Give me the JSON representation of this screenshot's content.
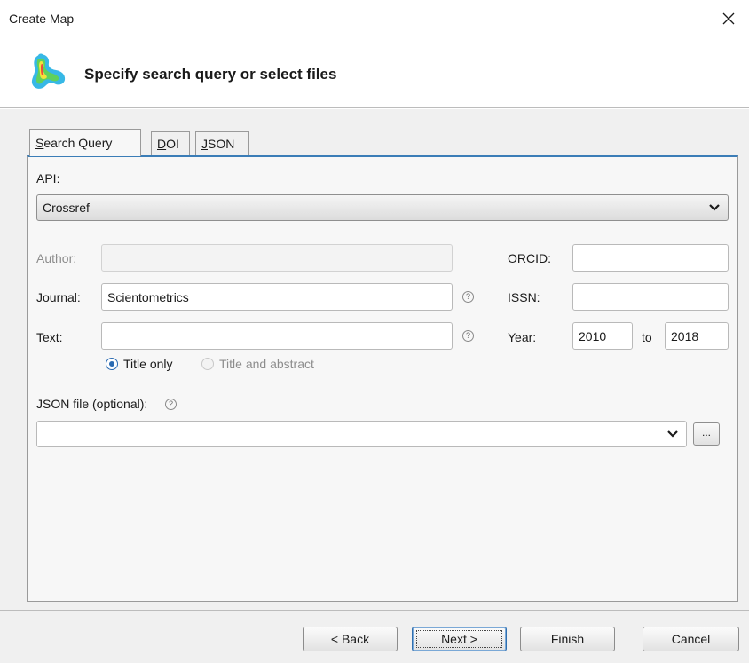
{
  "window": {
    "title": "Create Map"
  },
  "header": {
    "heading": "Specify search query or select files"
  },
  "tabs": [
    {
      "label": "Search Query",
      "mnemonic": "S",
      "rest": "earch Query"
    },
    {
      "label": "DOI",
      "mnemonic": "D",
      "rest": "OI"
    },
    {
      "label": "JSON",
      "mnemonic": "J",
      "rest": "SON"
    }
  ],
  "form": {
    "api_label": "API:",
    "api_value": "Crossref",
    "author_label": "Author:",
    "author_value": "",
    "journal_label": "Journal:",
    "journal_value": "Scientometrics",
    "text_label": "Text:",
    "text_value": "",
    "orcid_label": "ORCID:",
    "orcid_value": "",
    "issn_label": "ISSN:",
    "issn_value": "",
    "year_label": "Year:",
    "year_from": "2010",
    "year_to_label": "to",
    "year_to": "2018",
    "radio_title_only": "Title only",
    "radio_title_abstract": "Title and abstract",
    "json_label": "JSON file (optional):",
    "json_value": "",
    "browse_label": "..."
  },
  "help_glyph": "?",
  "buttons": {
    "back": "< Back",
    "next": "Next >",
    "finish": "Finish",
    "cancel": "Cancel"
  },
  "colors": {
    "accent": "#3b7db7",
    "background": "#f0f0f0"
  }
}
